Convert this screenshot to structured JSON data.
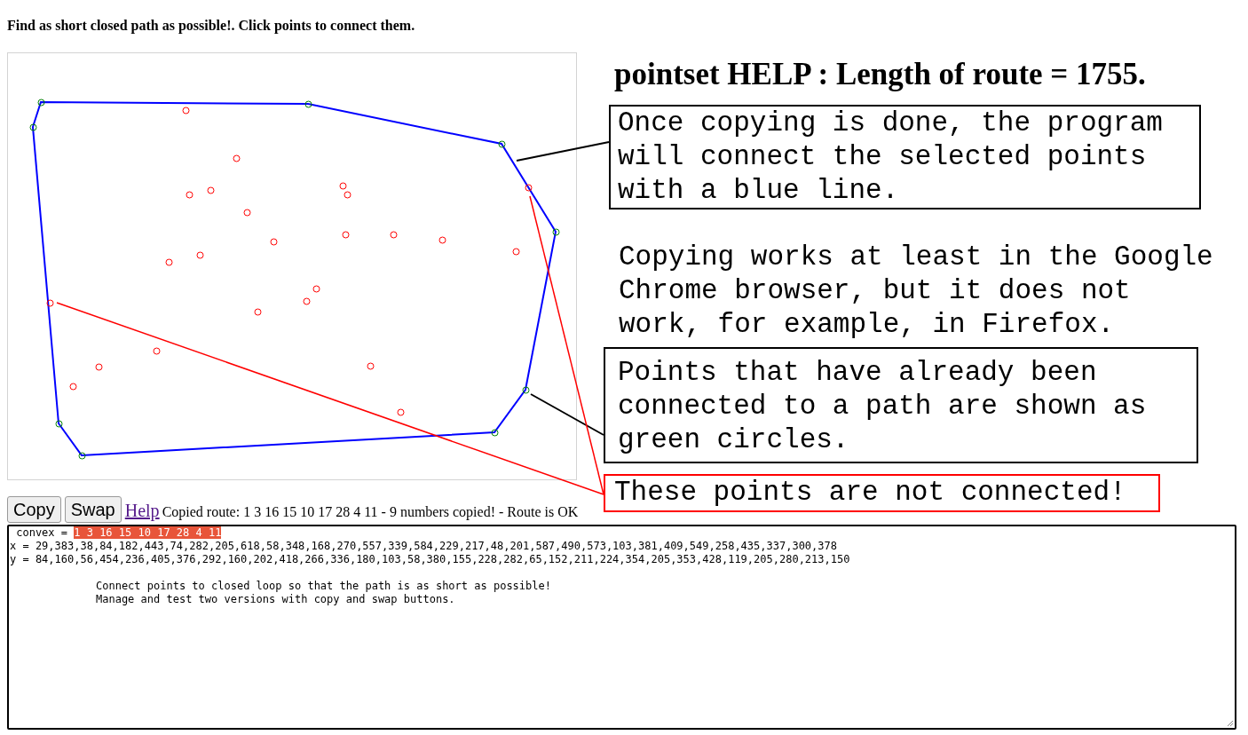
{
  "instruction": "Find as short closed path as possible!. Click points to connect them.",
  "toolbar": {
    "buttons": [
      "Copy",
      "Swap"
    ],
    "help_link": "Help",
    "status": "Copied route: 1 3 16 15 10 17 28 4 11 - 9 numbers copied! - Route is OK"
  },
  "editor": {
    "convex_label": "convex = ",
    "convex_route": "1 3 16 15 10 17 28 4 11",
    "x_line": "x = 29,383,38,84,182,443,74,282,205,618,58,348,168,270,557,339,584,229,217,48,201,587,490,573,103,381,409,549,258,435,337,300,378",
    "y_line": "y = 84,160,56,454,236,405,376,292,160,202,418,266,336,180,103,58,380,155,228,282,65,152,211,224,354,205,353,428,119,205,280,213,150",
    "notes": [
      "Connect points to closed loop so that the path is as short as possible!",
      "Manage and test two versions with copy and swap buttons."
    ]
  },
  "help": {
    "title": "pointset HELP : Length of route = 1755.",
    "callouts": [
      {
        "kind": "boxed",
        "text": "Once copying is done, the program will connect the selected points with a blue line."
      },
      {
        "kind": "plain",
        "text": "Copying works at least in the Google Chrome browser, but it does not work, for example, in Firefox."
      },
      {
        "kind": "boxed",
        "text": "Points that have already been connected to a path are shown as green circles."
      },
      {
        "kind": "warning",
        "text": "These points are not connected!"
      }
    ]
  }
}
